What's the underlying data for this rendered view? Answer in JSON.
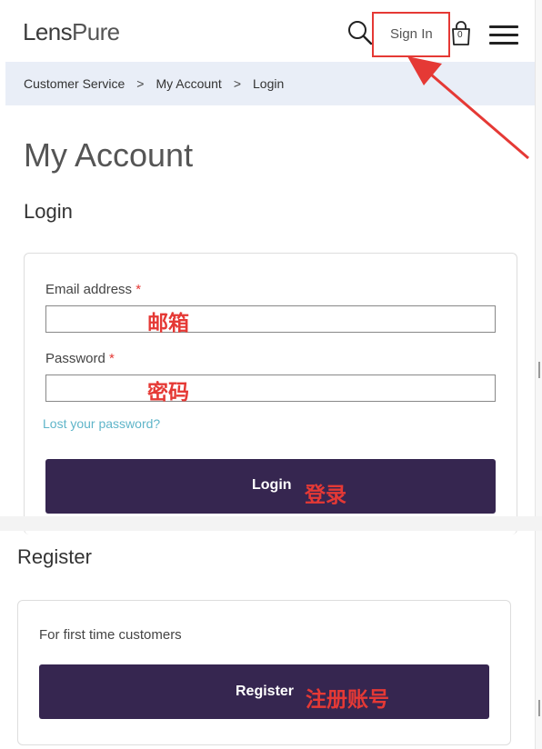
{
  "header": {
    "logo_lens": "Lens",
    "logo_pure": "Pure",
    "sign_in": "Sign In",
    "cart_count": "0",
    "icons": [
      "search-icon",
      "shopping-bag-icon",
      "hamburger-menu-icon"
    ]
  },
  "breadcrumb": {
    "items": [
      "Customer Service",
      "My Account",
      "Login"
    ],
    "separator": ">"
  },
  "page_title": "My Account",
  "login": {
    "heading": "Login",
    "email_label": "Email address",
    "password_label": "Password",
    "required_mark": "*",
    "email_value": "",
    "password_value": "",
    "lost_password": "Lost your password?",
    "button": "Login"
  },
  "register": {
    "heading": "Register",
    "subtext": "For first time customers",
    "button": "Register"
  },
  "annotations": {
    "email": "邮箱",
    "password": "密码",
    "login": "登录",
    "register": "注册账号"
  },
  "colors": {
    "primary_button": "#362650",
    "breadcrumb_bg": "#e9eef7",
    "link": "#5fb5c9",
    "annotation": "#e53935"
  }
}
